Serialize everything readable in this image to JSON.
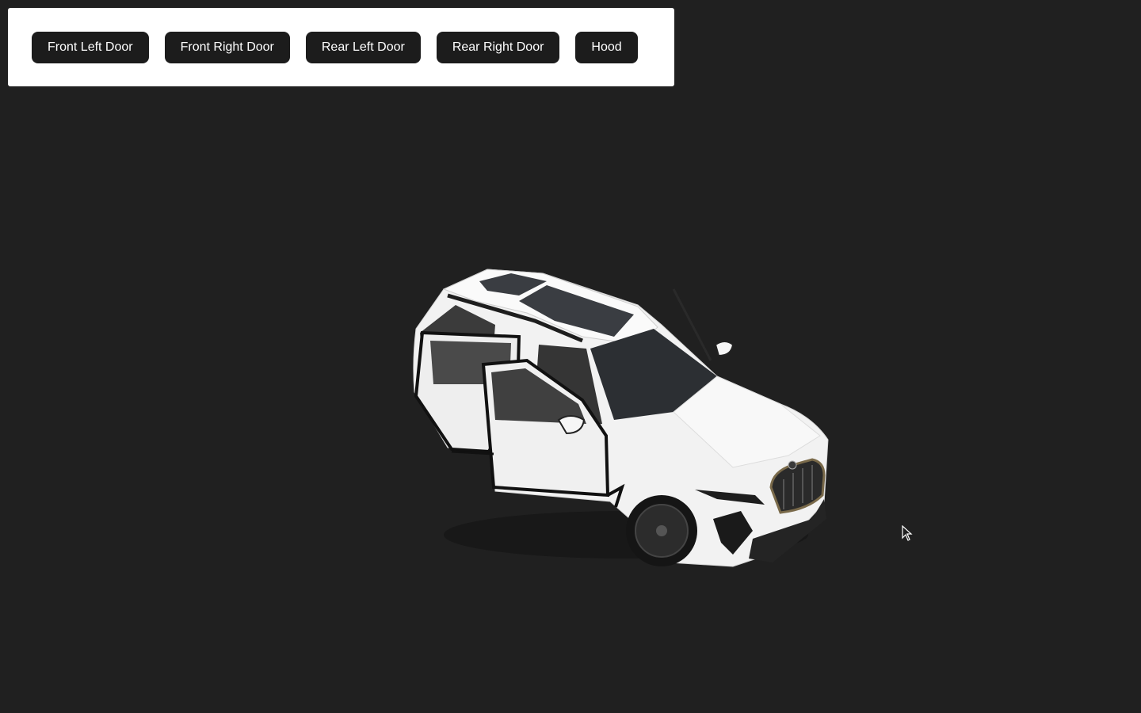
{
  "toolbar": {
    "buttons": [
      {
        "label": "Front Left Door"
      },
      {
        "label": "Front Right Door"
      },
      {
        "label": "Rear Left Door"
      },
      {
        "label": "Rear Right Door"
      },
      {
        "label": "Hood"
      }
    ]
  },
  "scene": {
    "background_color": "#202020",
    "model_color": "#f2f2f2"
  }
}
